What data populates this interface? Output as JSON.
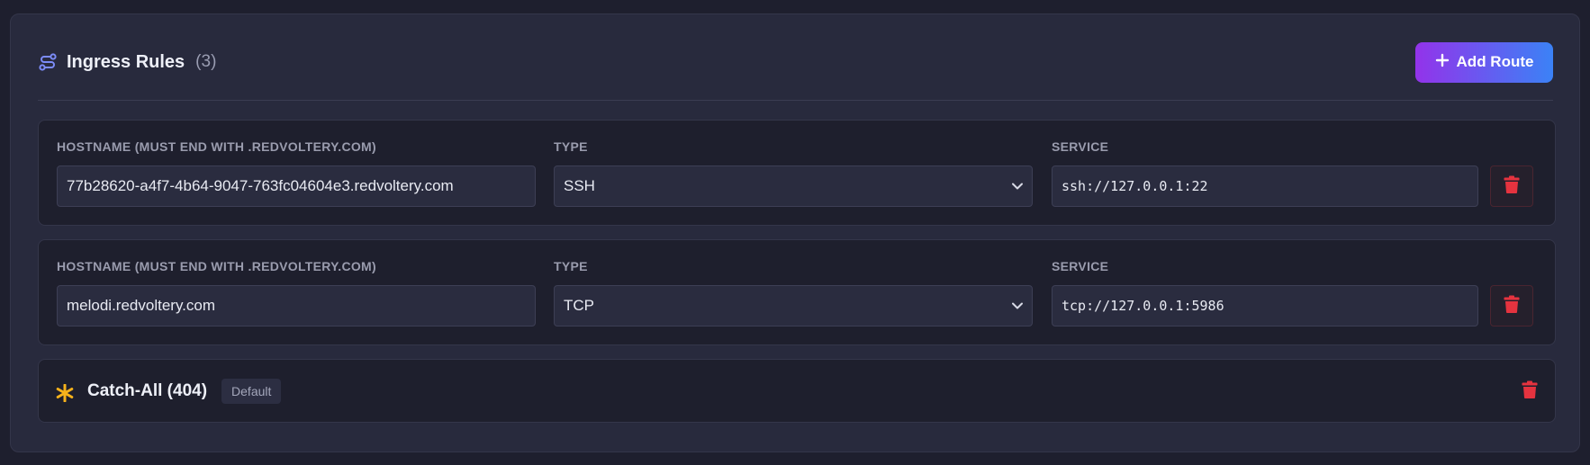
{
  "header": {
    "title": "Ingress Rules",
    "count": "(3)",
    "add_button_label": "Add Route",
    "title_icon": "route-icon",
    "add_icon": "plus-icon"
  },
  "rules": [
    {
      "hostname_label": "HOSTNAME (MUST END WITH .REDVOLTERY.COM)",
      "hostname_value": "77b28620-a4f7-4b64-9047-763fc04604e3.redvoltery.com",
      "type_label": "TYPE",
      "type_value": "SSH",
      "service_label": "SERVICE",
      "service_value": "ssh://127.0.0.1:22",
      "delete_icon": "trash-icon"
    },
    {
      "hostname_label": "HOSTNAME (MUST END WITH .REDVOLTERY.COM)",
      "hostname_value": "melodi.redvoltery.com",
      "type_label": "TYPE",
      "type_value": "TCP",
      "service_label": "SERVICE",
      "service_value": "tcp://127.0.0.1:5986",
      "delete_icon": "trash-icon"
    }
  ],
  "catch_all": {
    "icon": "asterisk-icon",
    "title": "Catch-All (404)",
    "badge": "Default",
    "delete_icon": "trash-icon"
  },
  "colors": {
    "accent_gradient_start": "#9333ea",
    "accent_gradient_end": "#3b82f6",
    "danger": "#e5333f",
    "catch_all_star": "#f6b21b",
    "title_icon": "#7c8cf8"
  }
}
